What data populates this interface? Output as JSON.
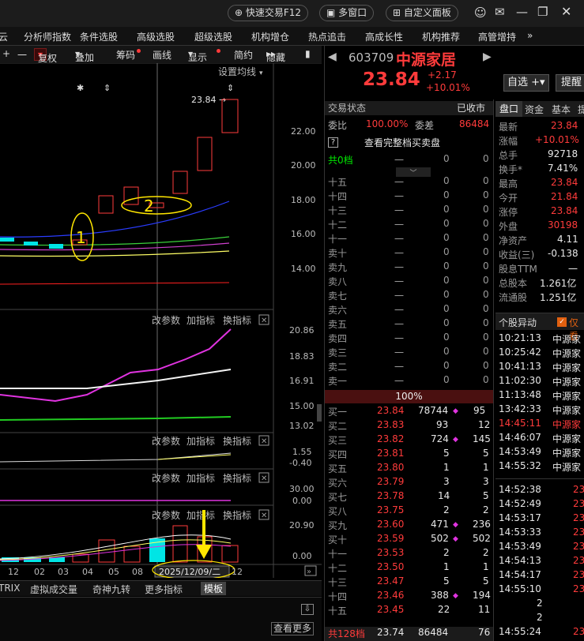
{
  "topbar": {
    "quick_trade": "快速交易F12",
    "multi_window": "多窗口",
    "custom_panel": "自定义面板"
  },
  "menu": [
    "云",
    "分析师指数",
    "条件选股",
    "高级选股",
    "超级选股",
    "机构增仓",
    "热点追击",
    "高成长性",
    "机构推荐",
    "高管增持"
  ],
  "toolbar": {
    "plus": "+",
    "minus": "一",
    "fq": "复权",
    "overlay": "叠加",
    "chip": "筹码",
    "draw": "画线",
    "display": "显示",
    "simple": "简约",
    "hide": "隐藏"
  },
  "kline": {
    "setting": "设置均线",
    "last_price": "23.84",
    "labels": [
      "22.00",
      "20.00",
      "18.00",
      "16.00",
      "14.00"
    ],
    "annot1": "1",
    "annot2": "2"
  },
  "sub1": {
    "btns": [
      "改参数",
      "加指标",
      "换指标"
    ],
    "labels": [
      "20.86",
      "18.83",
      "16.91",
      "15.00",
      "13.02"
    ]
  },
  "sub2": {
    "btns": [
      "改参数",
      "加指标",
      "换指标"
    ],
    "labels": [
      "1.55",
      "-0.40"
    ]
  },
  "sub3": {
    "btns": [
      "改参数",
      "加指标",
      "换指标"
    ],
    "labels": [
      "30.00",
      "0.00"
    ]
  },
  "sub4": {
    "btns": [
      "改参数",
      "加指标",
      "换指标"
    ],
    "labels": [
      "20.90",
      "0.00"
    ]
  },
  "xaxis": {
    "ticks": [
      "12",
      "02",
      "03",
      "04",
      "05",
      "08"
    ],
    "date": "2025/12/09/二",
    "end": "12"
  },
  "bottomtabs": [
    "TRIX",
    "虚拟成交量",
    "奇神九转",
    "更多指标",
    "模板"
  ],
  "more": "查看更多",
  "stock": {
    "code": "603709",
    "name": "中源家居",
    "price": "23.84",
    "change": "+2.17",
    "pct": "+10.01%",
    "watch": "自选",
    "remind": "提醒"
  },
  "status": {
    "label": "交易状态",
    "value": "已收市",
    "wb_label": "委比",
    "wb": "100.00%",
    "wc_label": "委差",
    "wc": "86484",
    "full": "查看完整档买卖盘",
    "level0": "共0档"
  },
  "sells": [
    {
      "n": "十五",
      "p": "一",
      "v": "0",
      "c": "0"
    },
    {
      "n": "十四",
      "p": "一",
      "v": "0",
      "c": "0"
    },
    {
      "n": "十三",
      "p": "一",
      "v": "0",
      "c": "0"
    },
    {
      "n": "十二",
      "p": "一",
      "v": "0",
      "c": "0"
    },
    {
      "n": "十一",
      "p": "一",
      "v": "0",
      "c": "0"
    },
    {
      "n": "卖十",
      "p": "一",
      "v": "0",
      "c": "0"
    },
    {
      "n": "卖九",
      "p": "一",
      "v": "0",
      "c": "0"
    },
    {
      "n": "卖八",
      "p": "一",
      "v": "0",
      "c": "0"
    },
    {
      "n": "卖七",
      "p": "一",
      "v": "0",
      "c": "0"
    },
    {
      "n": "卖六",
      "p": "一",
      "v": "0",
      "c": "0"
    },
    {
      "n": "卖五",
      "p": "一",
      "v": "0",
      "c": "0"
    },
    {
      "n": "卖四",
      "p": "一",
      "v": "0",
      "c": "0"
    },
    {
      "n": "卖三",
      "p": "一",
      "v": "0",
      "c": "0"
    },
    {
      "n": "卖二",
      "p": "一",
      "v": "0",
      "c": "0"
    },
    {
      "n": "卖一",
      "p": "一",
      "v": "0",
      "c": "0"
    }
  ],
  "ratio": "100%",
  "buys": [
    {
      "n": "买一",
      "p": "23.84",
      "v": "78744",
      "c": "95"
    },
    {
      "n": "买二",
      "p": "23.83",
      "v": "93",
      "c": "12"
    },
    {
      "n": "买三",
      "p": "23.82",
      "v": "724",
      "c": "145"
    },
    {
      "n": "买四",
      "p": "23.81",
      "v": "5",
      "c": "5"
    },
    {
      "n": "买五",
      "p": "23.80",
      "v": "1",
      "c": "1"
    },
    {
      "n": "买六",
      "p": "23.79",
      "v": "3",
      "c": "3"
    },
    {
      "n": "买七",
      "p": "23.78",
      "v": "14",
      "c": "5"
    },
    {
      "n": "买八",
      "p": "23.75",
      "v": "2",
      "c": "2"
    },
    {
      "n": "买九",
      "p": "23.60",
      "v": "471",
      "c": "236"
    },
    {
      "n": "买十",
      "p": "23.59",
      "v": "502",
      "c": "502"
    },
    {
      "n": "十一",
      "p": "23.53",
      "v": "2",
      "c": "2"
    },
    {
      "n": "十二",
      "p": "23.50",
      "v": "1",
      "c": "1"
    },
    {
      "n": "十三",
      "p": "23.47",
      "v": "5",
      "c": "5"
    },
    {
      "n": "十四",
      "p": "23.46",
      "v": "388",
      "c": "194"
    },
    {
      "n": "十五",
      "p": "23.45",
      "v": "22",
      "c": "11"
    }
  ],
  "total": {
    "label": "共128档",
    "p": "23.74",
    "v": "86484",
    "c": "76"
  },
  "tabs": [
    "盘口",
    "资金",
    "基本",
    "提"
  ],
  "quote": [
    {
      "k": "最新",
      "v": "23.84",
      "c": "red"
    },
    {
      "k": "涨幅",
      "v": "+10.01%",
      "c": "red"
    },
    {
      "k": "总手",
      "v": "92718",
      "c": "wht"
    },
    {
      "k": "换手*",
      "v": "7.41%",
      "c": "wht"
    },
    {
      "k": "最高",
      "v": "23.84",
      "c": "red"
    },
    {
      "k": "今开",
      "v": "21.84",
      "c": "red"
    },
    {
      "k": "涨停",
      "v": "23.84",
      "c": "red"
    },
    {
      "k": "外盘",
      "v": "30198",
      "c": "red"
    },
    {
      "k": "净资产",
      "v": "4.11",
      "c": "wht"
    },
    {
      "k": "收益(三)",
      "v": "-0.138",
      "c": "wht"
    },
    {
      "k": "股息TTM",
      "v": "一",
      "c": "wht"
    },
    {
      "k": "总股本",
      "v": "1.261亿",
      "c": "wht"
    },
    {
      "k": "流通股",
      "v": "1.251亿",
      "c": "wht"
    }
  ],
  "anomaly": {
    "title": "个股异动",
    "only": "仅看"
  },
  "anomalies": [
    {
      "t": "10:21:13",
      "n": "中源家",
      "hl": false
    },
    {
      "t": "10:25:42",
      "n": "中源家",
      "hl": false
    },
    {
      "t": "10:41:13",
      "n": "中源家",
      "hl": false
    },
    {
      "t": "11:02:30",
      "n": "中源家",
      "hl": false
    },
    {
      "t": "11:13:48",
      "n": "中源家",
      "hl": false
    },
    {
      "t": "13:42:33",
      "n": "中源家",
      "hl": false
    },
    {
      "t": "14:45:11",
      "n": "中源家",
      "hl": true
    },
    {
      "t": "14:46:07",
      "n": "中源家",
      "hl": false
    },
    {
      "t": "14:53:49",
      "n": "中源家",
      "hl": false
    },
    {
      "t": "14:55:32",
      "n": "中源家",
      "hl": false
    }
  ],
  "ticks": [
    {
      "t": "14:52:38",
      "v": "23"
    },
    {
      "t": "14:52:49",
      "v": "23"
    },
    {
      "t": "14:53:17",
      "v": "23"
    },
    {
      "t": "14:53:33",
      "v": "23"
    },
    {
      "t": "14:53:49",
      "v": "23"
    },
    {
      "t": "14:54:13",
      "v": "23"
    },
    {
      "t": "14:54:17",
      "v": "23"
    },
    {
      "t": "14:55:10",
      "v": "23"
    },
    {
      "t": "",
      "v": "2"
    },
    {
      "t": "",
      "v": "2"
    },
    {
      "t": "14:55:24",
      "v": "23"
    }
  ],
  "colors": {
    "up": "#ff3b3b",
    "down": "#00e600",
    "accent": "#ffff00",
    "bg": "#000000"
  }
}
